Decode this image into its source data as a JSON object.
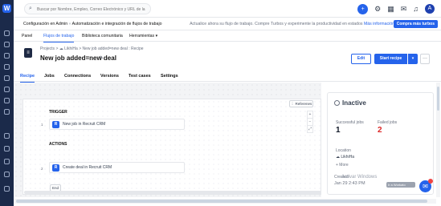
{
  "app": {
    "logo_letter": "W"
  },
  "topbar": {
    "search_placeholder": "Buscar por Nombre, Empleo, Correo Electrónico y URL de la",
    "search_icon": "search-icon",
    "bolt_icon": "bolt-icon",
    "avatar_letter": "A",
    "icons": [
      "settings-icon",
      "calendar-icon",
      "mail-icon",
      "bell-icon"
    ]
  },
  "infobar": {
    "config": "Configuración en Admin",
    "separator": "»",
    "automation": "Automatización e integración de flujos de trabajo",
    "message": "Actualice ahora su flujo de trabajo. Compre Turbos y experimente la productividad en estados",
    "link": "Más información",
    "button": "Compra más turbos"
  },
  "nav": {
    "items": [
      {
        "label": "Panel",
        "active": false
      },
      {
        "label": "Flujos de trabajo",
        "active": true
      },
      {
        "label": "Biblioteca comunitaria",
        "active": false
      },
      {
        "label": "Herramientas ▾",
        "active": false
      }
    ]
  },
  "header": {
    "breadcrumb": "Projects > ☁ LikhiHa > New job added=new deal : Recipe",
    "title": "New job added=new deal",
    "edit_label": "Edit",
    "start_label": "Start recipe",
    "caret": "▾",
    "dots": "···"
  },
  "tabs": [
    {
      "label": "Recipe",
      "active": true
    },
    {
      "label": "Jobs",
      "active": false
    },
    {
      "label": "Connections",
      "active": false
    },
    {
      "label": "Versions",
      "active": false
    },
    {
      "label": "Test cases",
      "active": false
    },
    {
      "label": "Settings",
      "active": false
    }
  ],
  "recipe": {
    "references": "⋮ Referenes",
    "zoom_in": "+",
    "zoom_out": "−",
    "zoom_fit": "⤢",
    "trigger_label": "TRIGGER",
    "actions_label": "ACTIONS",
    "steps": [
      {
        "num": "1",
        "logo": "R",
        "text": "New job in Recruit CRM"
      },
      {
        "num": "2",
        "logo": "R",
        "text": "Create deal in Recruit CRM"
      }
    ],
    "end_label": "End"
  },
  "panel": {
    "status": "Inactive",
    "successful_label": "Successful jobs",
    "successful_value": "1",
    "failed_label": "Failed jobs",
    "failed_value": "2",
    "location_label": "Location",
    "location_value": "☁ LikhiHa",
    "more": "+ More",
    "created_label": "Created",
    "created_date": "Jan 29 2:43 PM",
    "watermark": "Activar Windows",
    "version_text": "Ir a Workato",
    "chat_icon": "chat-icon",
    "colors": {
      "success": "#111827",
      "failed": "#dc2626",
      "accent": "#2563eb"
    }
  }
}
